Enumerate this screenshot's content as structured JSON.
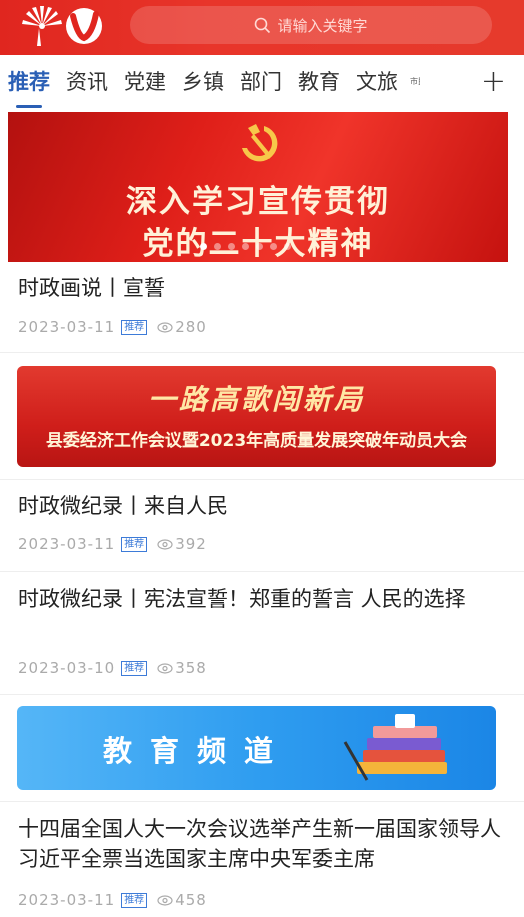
{
  "header": {
    "search_placeholder": "请输入关键字"
  },
  "tabs": [
    {
      "label": "推荐",
      "active": true
    },
    {
      "label": "资讯"
    },
    {
      "label": "党建"
    },
    {
      "label": "乡镇"
    },
    {
      "label": "部门"
    },
    {
      "label": "教育"
    },
    {
      "label": "文旅"
    },
    {
      "label": "市民"
    }
  ],
  "add_tab_label": "+",
  "banner": {
    "line1": "深入学习宣传贯彻",
    "line2": "党的二十大精神",
    "dots_total": 7,
    "active_dot": 0
  },
  "articles": [
    {
      "title": "时政画说丨宣誓",
      "date": "2023-03-11",
      "badge": "推荐",
      "views": "280"
    },
    {
      "title": "时政微纪录丨来自人民",
      "date": "2023-03-11",
      "badge": "推荐",
      "views": "392"
    },
    {
      "title": "时政微纪录丨宪法宣誓！郑重的誓言 人民的选择",
      "date": "2023-03-10",
      "badge": "推荐",
      "views": "358"
    },
    {
      "title": "十四届全国人大一次会议选举产生新一届国家领导人 习近平全票当选国家主席中央军委主席",
      "date": "2023-03-11",
      "badge": "推荐",
      "views": "458"
    }
  ],
  "ad_news": {
    "title": "一路高歌闯新局",
    "subtitle": "县委经济工作会议暨2023年高质量发展突破年动员大会"
  },
  "ad_edu": {
    "title": "教育频道"
  },
  "colors": {
    "header": "#e0261f",
    "tab_active": "#2a5fb5",
    "badge": "#3d7bd8"
  }
}
